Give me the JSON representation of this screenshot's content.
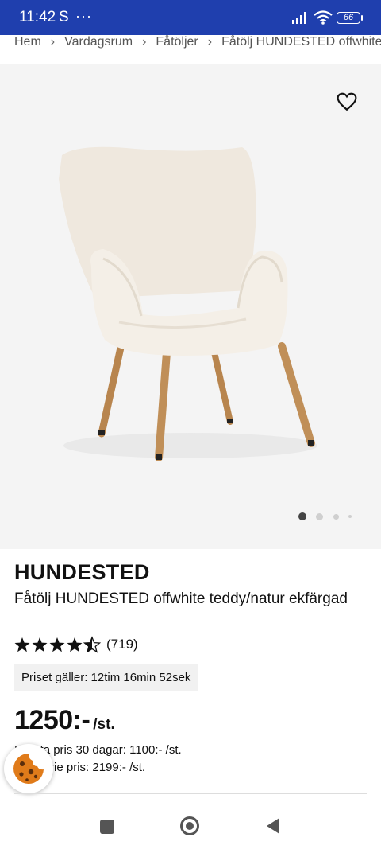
{
  "status_bar": {
    "time": "11:42",
    "carrier_icon": "S",
    "more_dots": "···",
    "battery": "66"
  },
  "breadcrumb": [
    "Hem",
    "Vardagsrum",
    "Fåtöljer",
    "Fåtölj HUNDESTED offwhite t"
  ],
  "gallery": {
    "page_count": 4,
    "active_page": 1
  },
  "product": {
    "brand": "HUNDESTED",
    "name": "Fåtölj HUNDESTED offwhite teddy/natur ekfärgad",
    "rating_stars": 4.5,
    "rating_count": "(719)",
    "price_validity": "Priset gäller: 12tim 16min 52sek",
    "price": "1250:-",
    "price_unit": "/st.",
    "lowest_price_30_days": "Lägsta pris 30 dagar: 1100:- /st.",
    "ordinary_price": "Ordinarie pris: 2199:- /st."
  },
  "colors": {
    "status_bar": "#1f3fae",
    "gallery_bg": "#f4f4f4",
    "timer_bg": "#f1f1f1"
  },
  "icons": {
    "favorite": "heart-outline-icon",
    "cookie": "cookie-icon",
    "nav_recents": "square-icon",
    "nav_home": "circle-icon",
    "nav_back": "triangle-back-icon"
  }
}
